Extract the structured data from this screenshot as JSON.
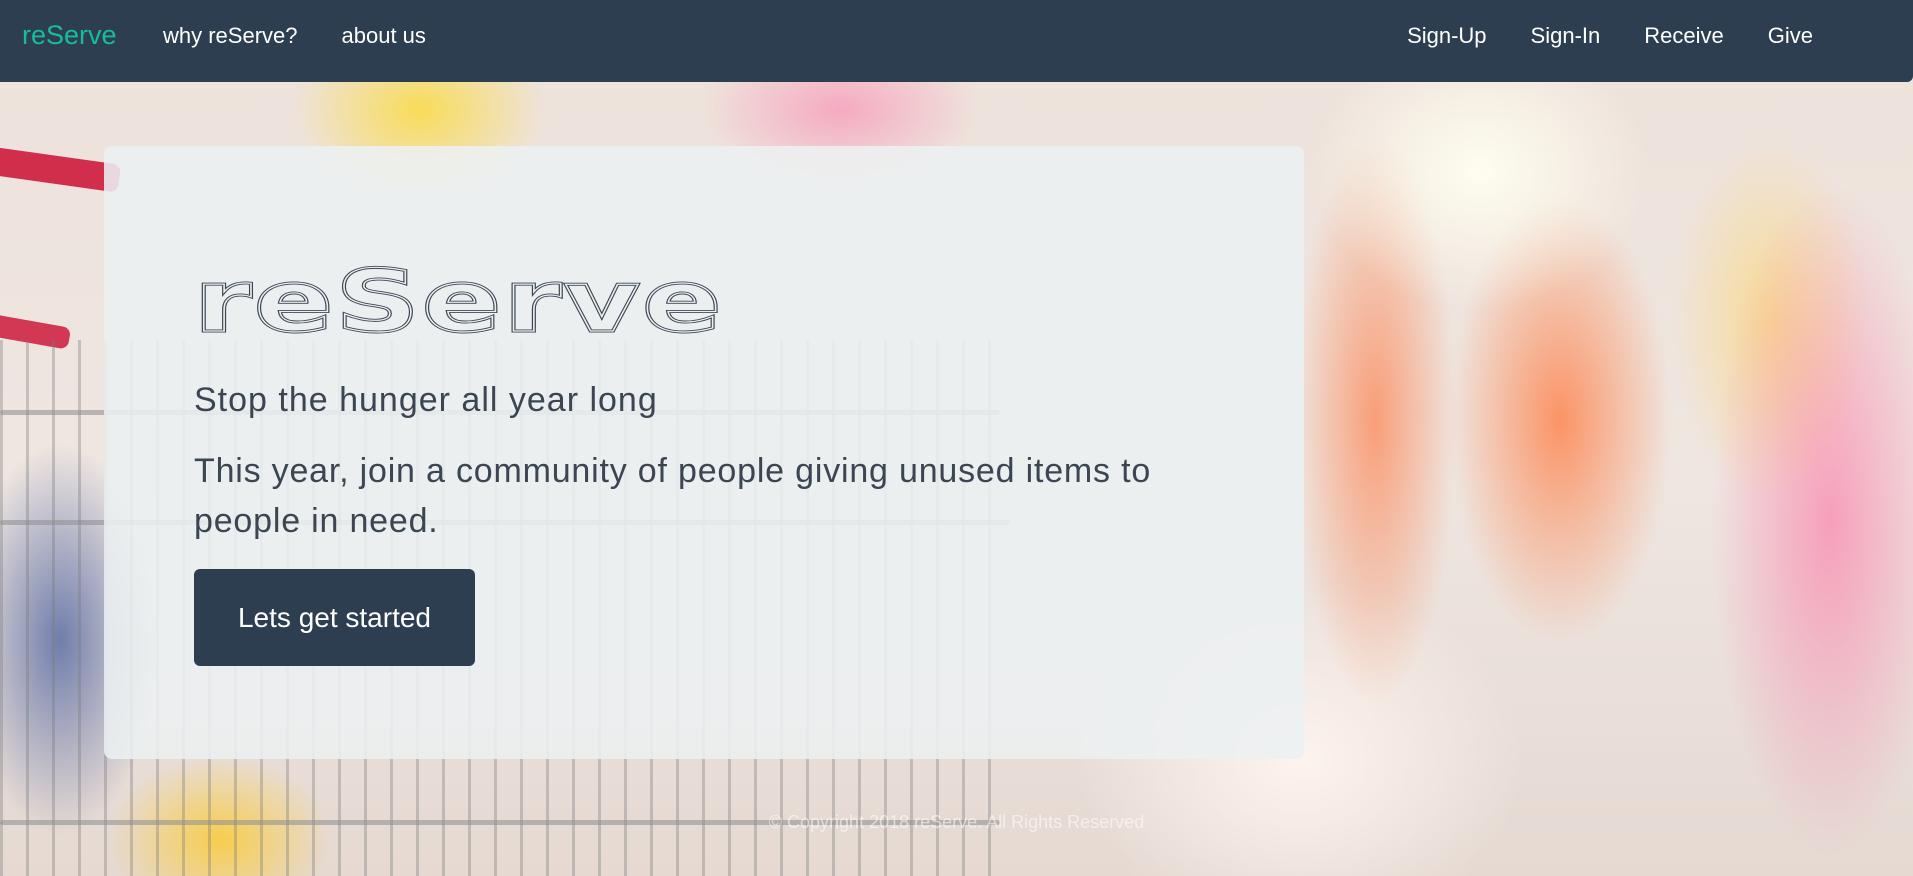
{
  "navbar": {
    "brand": "reServe",
    "left_links": [
      "why reServe?",
      "about us"
    ],
    "right_links": [
      "Sign-Up",
      "Sign-In",
      "Receive",
      "Give"
    ],
    "background_color": "#2c3e50",
    "brand_color": "#18bc9c"
  },
  "hero": {
    "logo_text": "reServe",
    "tagline": "Stop the hunger all year long",
    "description": "This year, join a community of people giving unused items to people in need.",
    "cta_label": "Lets get started"
  },
  "footer": {
    "copyright": "© Copyright 2018 reServe. All Rights Reserved"
  }
}
